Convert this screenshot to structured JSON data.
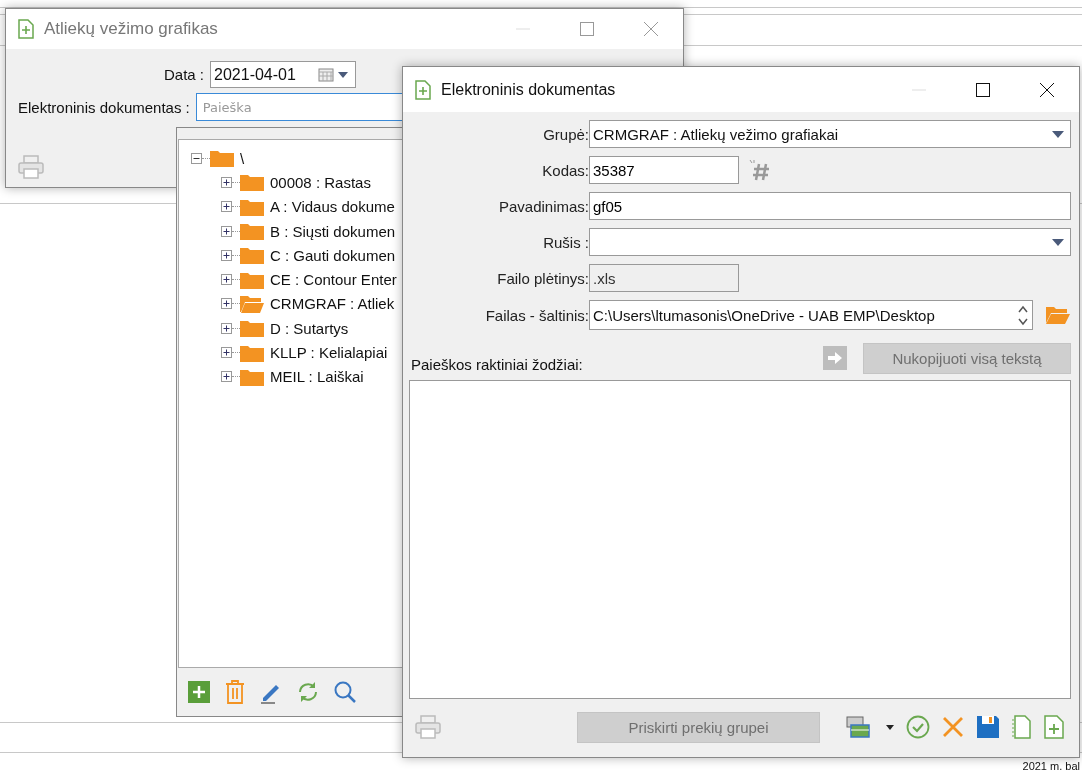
{
  "schedule_window": {
    "title": "Atliekų vežimo grafikas",
    "date_label": "Data :",
    "date_value": "2021-04-01",
    "document_label": "Elektroninis dokumentas :",
    "search_placeholder": "Paieška"
  },
  "tree": {
    "items": [
      {
        "label": "\\",
        "expanded": true,
        "selected": false,
        "children": [
          {
            "label": "00008 : Rastas",
            "expanded": false,
            "selected": false
          },
          {
            "label": "A : Vidaus dokume",
            "expanded": false,
            "selected": false
          },
          {
            "label": "B : Siųsti dokumen",
            "expanded": false,
            "selected": false
          },
          {
            "label": "C : Gauti dokumen",
            "expanded": false,
            "selected": false
          },
          {
            "label": "CE : Contour Enter",
            "expanded": false,
            "selected": false
          },
          {
            "label": "CRMGRAF : Atliek",
            "expanded": false,
            "selected": true
          },
          {
            "label": "D : Sutartys",
            "expanded": false,
            "selected": false
          },
          {
            "label": "KLLP : Kelialapiai",
            "expanded": false,
            "selected": false
          },
          {
            "label": "MEIL : Laiškai",
            "expanded": false,
            "selected": false
          }
        ]
      }
    ]
  },
  "document_window": {
    "title": "Elektroninis dokumentas",
    "fields": [
      {
        "kind": "select",
        "label": "Grupė:",
        "value": "CRMGRAF : Atliekų vežimo grafiakai"
      },
      {
        "kind": "code",
        "label": "Kodas:",
        "value": "35387"
      },
      {
        "kind": "text",
        "label": "Pavadinimas:",
        "value": "gf05"
      },
      {
        "kind": "select",
        "label": "Rušis :"
      },
      {
        "kind": "readonly",
        "label": "Failo plėtinys:",
        "value": ".xls"
      },
      {
        "kind": "path",
        "label": "Failas - šaltinis:",
        "value": "C:\\Users\\ltumasonis\\OneDrive - UAB EMP\\Desktop"
      }
    ],
    "keywords_label": "Paieškos raktiniai žodžiai:",
    "copy_button": {
      "label": "Nukopijuoti visą tekstą",
      "disabled": true
    },
    "assign_button": {
      "label": "Priskirti prekių grupei",
      "disabled": true
    }
  },
  "status_text": "2021 m. bal"
}
